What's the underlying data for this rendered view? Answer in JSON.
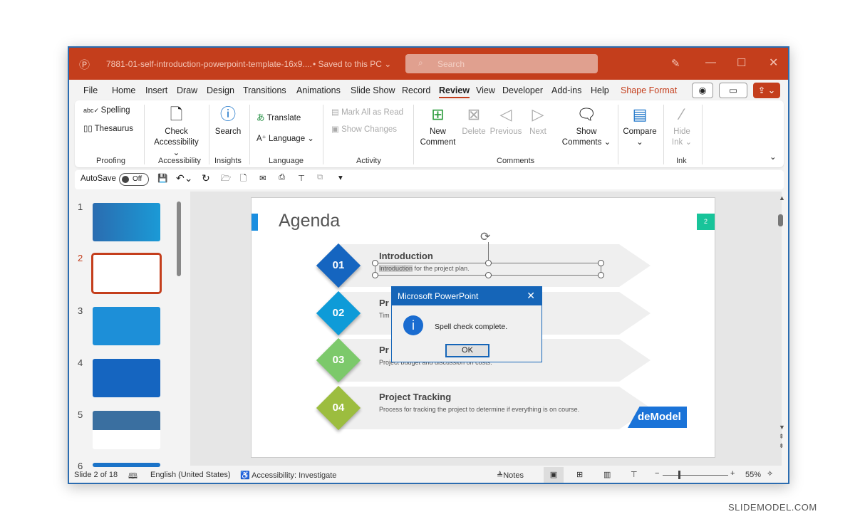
{
  "window": {
    "file_name": "7881-01-self-introduction-powerpoint-template-16x9....",
    "save_status": "• Saved to this PC ⌄",
    "search_placeholder": "Search",
    "accent": "#c43e1c"
  },
  "tabs": [
    "File",
    "Home",
    "Insert",
    "Draw",
    "Design",
    "Transitions",
    "Animations",
    "Slide Show",
    "Record",
    "Review",
    "View",
    "Developer",
    "Add-ins",
    "Help",
    "Shape Format"
  ],
  "active_tab": "Review",
  "ribbon": {
    "proofing": {
      "label": "Proofing",
      "spelling": "Spelling",
      "thesaurus": "Thesaurus"
    },
    "accessibility": {
      "label": "Accessibility",
      "check": "Check",
      "check2": "Accessibility ⌄"
    },
    "insights": {
      "label": "Insights",
      "search": "Search"
    },
    "language": {
      "label": "Language",
      "translate": "Translate",
      "language": "Language ⌄"
    },
    "activity": {
      "label": "Activity",
      "mark_all": "Mark All as Read",
      "show_changes": "Show Changes"
    },
    "comments": {
      "label": "Comments",
      "new1": "New",
      "new2": "Comment",
      "delete": "Delete",
      "previous": "Previous",
      "next": "Next",
      "show1": "Show",
      "show2": "Comments ⌄"
    },
    "compare": {
      "label": "Compare"
    },
    "ink": {
      "label": "Ink",
      "hide1": "Hide",
      "hide2": "Ink ⌄"
    }
  },
  "qat": {
    "autosave": "AutoSave",
    "toggle": "Off"
  },
  "thumbnails": [
    {
      "n": "1"
    },
    {
      "n": "2"
    },
    {
      "n": "3"
    },
    {
      "n": "4"
    },
    {
      "n": "5"
    },
    {
      "n": "6"
    }
  ],
  "slide": {
    "title": "Agenda",
    "page_num": "2",
    "items": [
      {
        "num": "01",
        "title": "Introduction",
        "desc_hl": "Introduction",
        "desc": " for the project plan.",
        "color": "#1565c0"
      },
      {
        "num": "02",
        "title": "Pr",
        "desc": "Tim",
        "color": "#0e9bd8"
      },
      {
        "num": "03",
        "title": "Pr",
        "desc": "Project budget and discussion on costs.",
        "color": "#7cc96b"
      },
      {
        "num": "04",
        "title": "Project Tracking",
        "desc": "Process for tracking the project to determine if everything is on course.",
        "color": "#9cbd3f"
      }
    ],
    "logo": "deModel"
  },
  "dialog": {
    "title": "Microsoft PowerPoint",
    "message": "Spell check complete.",
    "ok": "OK"
  },
  "status": {
    "slide": "Slide 2 of 18",
    "language": "English (United States)",
    "accessibility": "Accessibility: Investigate",
    "notes": "Notes",
    "zoom": "55%"
  },
  "watermark": "SLIDEMODEL.COM"
}
